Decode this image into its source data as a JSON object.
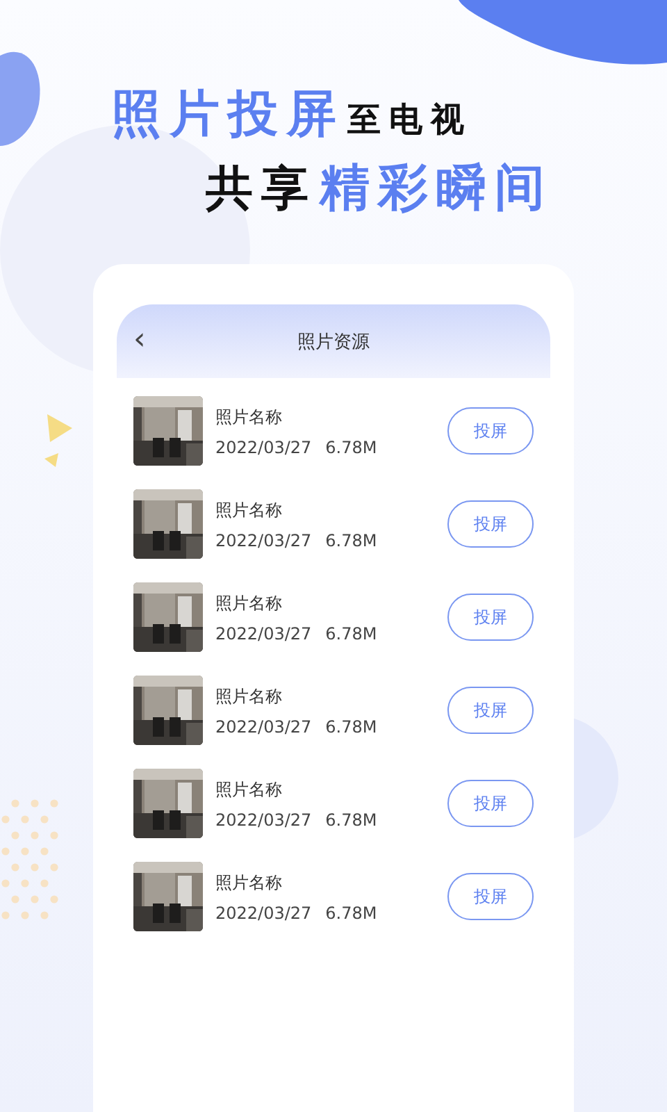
{
  "headline": [
    {
      "segments": [
        {
          "text": "照片投屏",
          "highlight": true
        },
        {
          "text": "至电视",
          "highlight": false
        }
      ]
    },
    {
      "segments": [
        {
          "text": "共享",
          "highlight": false
        },
        {
          "text": "精彩瞬间",
          "highlight": true
        }
      ]
    }
  ],
  "screen": {
    "back": "‹",
    "title": "照片资源",
    "items": [
      {
        "name": "照片名称",
        "date": "2022/03/27",
        "size": "6.78M",
        "button": "投屏"
      },
      {
        "name": "照片名称",
        "date": "2022/03/27",
        "size": "6.78M",
        "button": "投屏"
      },
      {
        "name": "照片名称",
        "date": "2022/03/27",
        "size": "6.78M",
        "button": "投屏"
      },
      {
        "name": "照片名称",
        "date": "2022/03/27",
        "size": "6.78M",
        "button": "投屏"
      },
      {
        "name": "照片名称",
        "date": "2022/03/27",
        "size": "6.78M",
        "button": "投屏"
      },
      {
        "name": "照片名称",
        "date": "2022/03/27",
        "size": "6.78M",
        "button": "投屏"
      }
    ]
  }
}
